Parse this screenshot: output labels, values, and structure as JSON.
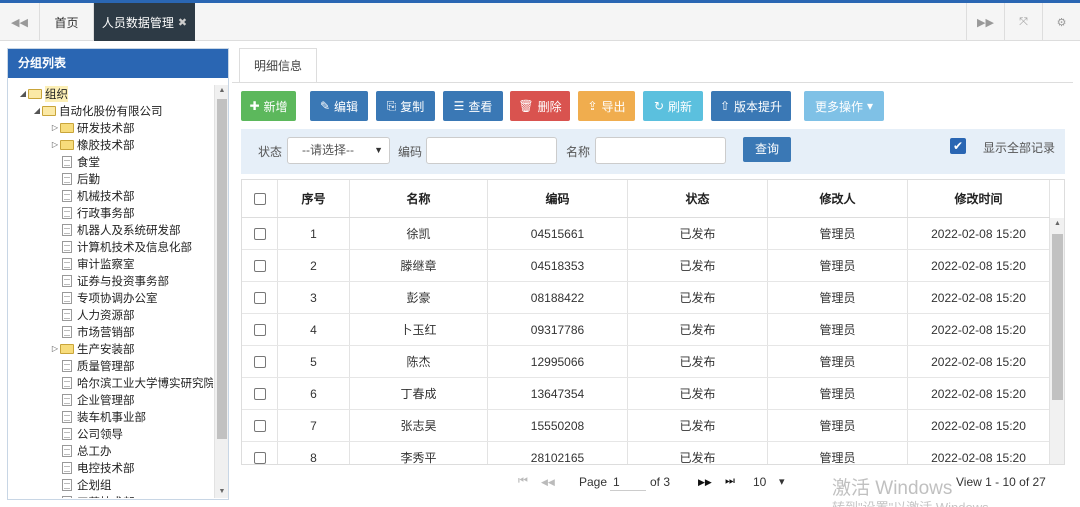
{
  "tabs": {
    "home": "首页",
    "active": "人员数据管理",
    "close_glyph": "✖",
    "prev_glyph": "◀◀",
    "next_glyph": "▶▶",
    "fullscreen_glyph": "⤧",
    "settings_glyph": "⚙"
  },
  "sidebar": {
    "title": "分组列表",
    "tree": [
      {
        "label": "组织",
        "level": 0,
        "type": "folder-open",
        "toggle": "◢",
        "selected": true
      },
      {
        "label": "自动化股份有限公司",
        "level": 1,
        "type": "folder-open",
        "toggle": "◢"
      },
      {
        "label": "研发技术部",
        "level": 2,
        "type": "folder",
        "toggle": "▷"
      },
      {
        "label": "橡胶技术部",
        "level": 2,
        "type": "folder",
        "toggle": "▷"
      },
      {
        "label": "食堂",
        "level": 2,
        "type": "doc"
      },
      {
        "label": "后勤",
        "level": 2,
        "type": "doc"
      },
      {
        "label": "机械技术部",
        "level": 2,
        "type": "doc"
      },
      {
        "label": "行政事务部",
        "level": 2,
        "type": "doc"
      },
      {
        "label": "机器人及系统研发部",
        "level": 2,
        "type": "doc"
      },
      {
        "label": "计算机技术及信息化部",
        "level": 2,
        "type": "doc"
      },
      {
        "label": "审计监察室",
        "level": 2,
        "type": "doc"
      },
      {
        "label": "证券与投资事务部",
        "level": 2,
        "type": "doc"
      },
      {
        "label": "专项协调办公室",
        "level": 2,
        "type": "doc"
      },
      {
        "label": "人力资源部",
        "level": 2,
        "type": "doc"
      },
      {
        "label": "市场营销部",
        "level": 2,
        "type": "doc"
      },
      {
        "label": "生产安装部",
        "level": 2,
        "type": "folder",
        "toggle": "▷"
      },
      {
        "label": "质量管理部",
        "level": 2,
        "type": "doc"
      },
      {
        "label": "哈尔滨工业大学博实研究院",
        "level": 2,
        "type": "doc"
      },
      {
        "label": "企业管理部",
        "level": 2,
        "type": "doc"
      },
      {
        "label": "装车机事业部",
        "level": 2,
        "type": "doc"
      },
      {
        "label": "公司领导",
        "level": 2,
        "type": "doc"
      },
      {
        "label": "总工办",
        "level": 2,
        "type": "doc"
      },
      {
        "label": "电控技术部",
        "level": 2,
        "type": "doc"
      },
      {
        "label": "企划组",
        "level": 2,
        "type": "doc"
      },
      {
        "label": "工艺技术部",
        "level": 2,
        "type": "doc"
      }
    ]
  },
  "main": {
    "subtab": "明细信息",
    "toolbar": [
      {
        "label": "新增",
        "icon": "✚",
        "color": "green"
      },
      {
        "label": "编辑",
        "icon": "✎",
        "color": "blue"
      },
      {
        "label": "复制",
        "icon": "⎘",
        "color": "blue"
      },
      {
        "label": "查看",
        "icon": "☰",
        "color": "blue"
      },
      {
        "label": "删除",
        "icon": "🗑",
        "color": "red"
      },
      {
        "label": "导出",
        "icon": "⇪",
        "color": "orange"
      },
      {
        "label": "刷新",
        "icon": "↻",
        "color": "cyan"
      },
      {
        "label": "版本提升",
        "icon": "⇧",
        "color": "blue"
      },
      {
        "label": "更多操作",
        "icon": "▾",
        "color": "light"
      }
    ],
    "search": {
      "status_label": "状态",
      "status_value": "--请选择--",
      "code_label": "编码",
      "code_value": "",
      "name_label": "名称",
      "name_value": "",
      "query_button": "查询",
      "show_all_label": "显示全部记录",
      "show_all_checked": true
    },
    "table": {
      "columns": [
        "序号",
        "名称",
        "编码",
        "状态",
        "修改人",
        "修改时间"
      ],
      "rows": [
        {
          "no": "1",
          "name": "徐凯",
          "code": "04515661",
          "status": "已发布",
          "modifier": "管理员",
          "time": "2022-02-08 15:20"
        },
        {
          "no": "2",
          "name": "滕继章",
          "code": "04518353",
          "status": "已发布",
          "modifier": "管理员",
          "time": "2022-02-08 15:20"
        },
        {
          "no": "3",
          "name": "彭豪",
          "code": "08188422",
          "status": "已发布",
          "modifier": "管理员",
          "time": "2022-02-08 15:20"
        },
        {
          "no": "4",
          "name": "卜玉红",
          "code": "09317786",
          "status": "已发布",
          "modifier": "管理员",
          "time": "2022-02-08 15:20"
        },
        {
          "no": "5",
          "name": "陈杰",
          "code": "12995066",
          "status": "已发布",
          "modifier": "管理员",
          "time": "2022-02-08 15:20"
        },
        {
          "no": "6",
          "name": "丁春成",
          "code": "13647354",
          "status": "已发布",
          "modifier": "管理员",
          "time": "2022-02-08 15:20"
        },
        {
          "no": "7",
          "name": "张志昊",
          "code": "15550208",
          "status": "已发布",
          "modifier": "管理员",
          "time": "2022-02-08 15:20"
        },
        {
          "no": "8",
          "name": "李秀平",
          "code": "28102165",
          "status": "已发布",
          "modifier": "管理员",
          "time": "2022-02-08 15:20"
        }
      ]
    },
    "pager": {
      "first": "⏮",
      "prev": "◀◀",
      "page_label": "Page",
      "page_value": "1",
      "of_label": "of 3",
      "next": "▶▶",
      "last": "⏭",
      "page_size": "10",
      "page_size_caret": "▾",
      "view_text": "View 1 - 10 of 27"
    }
  },
  "watermark": {
    "line1": "激活 Windows",
    "line2": "转到\"设置\"以激活 Windows。"
  }
}
